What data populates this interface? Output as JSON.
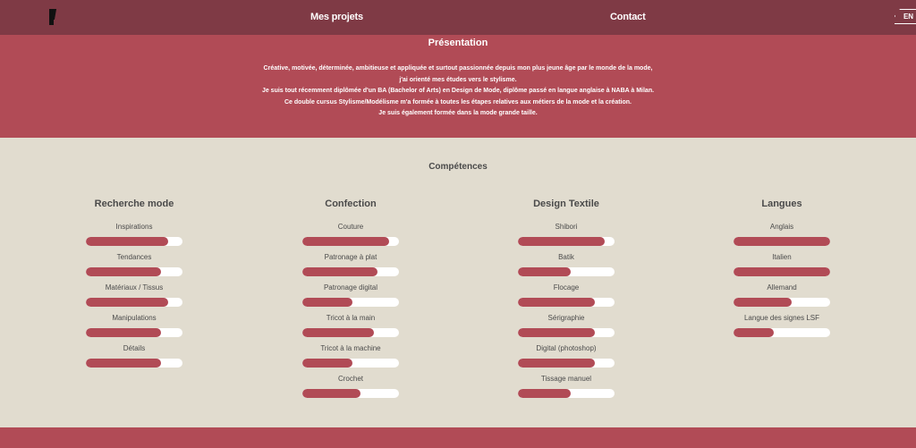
{
  "nav": {
    "projects": "Mes projets",
    "contact": "Contact",
    "lang": "EN"
  },
  "presentation": {
    "title": "Présentation",
    "lines": [
      "Créative, motivée, déterminée, ambitieuse et appliquée et surtout passionnée depuis mon plus jeune âge par le monde de la mode,",
      "j'ai orienté mes études vers le stylisme.",
      "Je suis tout récemment diplômée d'un BA (Bachelor of Arts) en Design de Mode, diplôme passé en langue anglaise à NABA à Milan.",
      "Ce double cursus Stylisme/Modélisme m'a formée à toutes les étapes relatives aux métiers de la mode et la création.",
      "Je suis également formée dans la mode grande taille."
    ]
  },
  "skills": {
    "title": "Compétences",
    "columns": [
      {
        "title": "Recherche mode",
        "items": [
          {
            "label": "Inspirations",
            "level": 0.85
          },
          {
            "label": "Tendances",
            "level": 0.78
          },
          {
            "label": "Matériaux / Tissus",
            "level": 0.85
          },
          {
            "label": "Manipulations",
            "level": 0.78
          },
          {
            "label": "Détails",
            "level": 0.78
          }
        ]
      },
      {
        "title": "Confection",
        "items": [
          {
            "label": "Couture",
            "level": 0.9
          },
          {
            "label": "Patronage à plat",
            "level": 0.78
          },
          {
            "label": "Patronage digital",
            "level": 0.52
          },
          {
            "label": "Tricot à la main",
            "level": 0.74
          },
          {
            "label": "Tricot à la machine",
            "level": 0.52
          },
          {
            "label": "Crochet",
            "level": 0.6
          }
        ]
      },
      {
        "title": "Design Textile",
        "items": [
          {
            "label": "Shibori",
            "level": 0.9
          },
          {
            "label": "Batik",
            "level": 0.55
          },
          {
            "label": "Flocage",
            "level": 0.8
          },
          {
            "label": "Sérigraphie",
            "level": 0.8
          },
          {
            "label": "Digital (photoshop)",
            "level": 0.8
          },
          {
            "label": "Tissage manuel",
            "level": 0.55
          }
        ]
      },
      {
        "title": "Langues",
        "items": [
          {
            "label": "Anglais",
            "level": 1.0
          },
          {
            "label": "Italien",
            "level": 1.0
          },
          {
            "label": "Allemand",
            "level": 0.6
          },
          {
            "label": "Langue des signes LSF",
            "level": 0.42
          }
        ]
      }
    ]
  },
  "colors": {
    "header": "#7f3a45",
    "accent": "#b14b56",
    "background": "#e1dccf"
  }
}
